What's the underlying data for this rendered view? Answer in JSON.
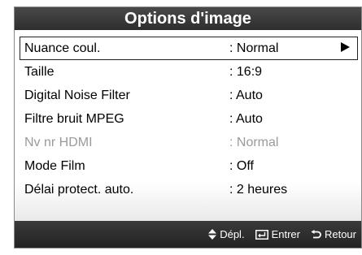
{
  "menu": {
    "title": "Options d'image",
    "items": [
      {
        "label": "Nuance coul.",
        "value": ": Normal",
        "selected": true,
        "disabled": false
      },
      {
        "label": "Taille",
        "value": ": 16:9",
        "selected": false,
        "disabled": false
      },
      {
        "label": "Digital Noise Filter",
        "value": ": Auto",
        "selected": false,
        "disabled": false
      },
      {
        "label": "Filtre bruit MPEG",
        "value": ": Auto",
        "selected": false,
        "disabled": false
      },
      {
        "label": "Nv nr HDMI",
        "value": ": Normal",
        "selected": false,
        "disabled": true
      },
      {
        "label": "Mode Film",
        "value": ": Off",
        "selected": false,
        "disabled": false
      },
      {
        "label": "Délai protect. auto.",
        "value": ": 2 heures",
        "selected": false,
        "disabled": false
      }
    ]
  },
  "footer": {
    "move_label": "Dépl.",
    "move_icon": "up-down-arrows-icon",
    "enter_label": "Entrer",
    "enter_icon": "enter-icon",
    "return_label": "Retour",
    "return_icon": "return-icon"
  },
  "colors": {
    "header_bg": "#3a3a3a",
    "footer_bg": "#2b2b2b",
    "disabled_text": "#9a9a9a"
  }
}
